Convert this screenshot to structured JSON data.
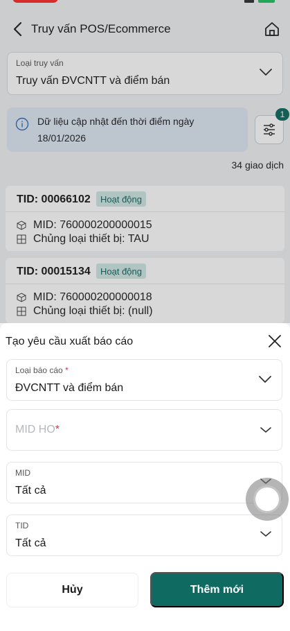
{
  "header": {
    "title": "Truy vấn POS/Ecommerce"
  },
  "query": {
    "label": "Loại truy vấn",
    "value": "Truy vấn ĐVCNTT và điểm bán"
  },
  "info": {
    "line1": "Dữ liệu cập nhật đến thời điểm ngày",
    "line2": "18/01/2026"
  },
  "filter": {
    "badge": "1"
  },
  "transaction_count": "34 giao dịch",
  "cards": [
    {
      "tid": "TID: 00066102",
      "status": "Hoạt động",
      "mid": "MID: 760000200000015",
      "device": "Chủng loại thiết bị: TAU"
    },
    {
      "tid": "TID: 00015134",
      "status": "Hoạt động",
      "mid": "MID: 760000200000018",
      "device": "Chủng loại thiết bị: (null)"
    }
  ],
  "sheet": {
    "title": "Tạo yêu cầu xuất báo cáo",
    "report_type": {
      "label": "Loại báo cáo",
      "required": "*",
      "value": "ĐVCNTT và điểm bán"
    },
    "mid_ho": {
      "placeholder": "MID HO",
      "required": "*"
    },
    "mid": {
      "label": "MID",
      "value": "Tất cả"
    },
    "tid": {
      "label": "TID",
      "value": "Tất cả"
    },
    "cancel_label": "Hủy",
    "add_label": "Thêm mới"
  },
  "colors": {
    "primary": "#0f6b62",
    "chip_bg": "#cfe7e3",
    "info_bg": "#dfe9f5",
    "required": "#d9304f"
  }
}
